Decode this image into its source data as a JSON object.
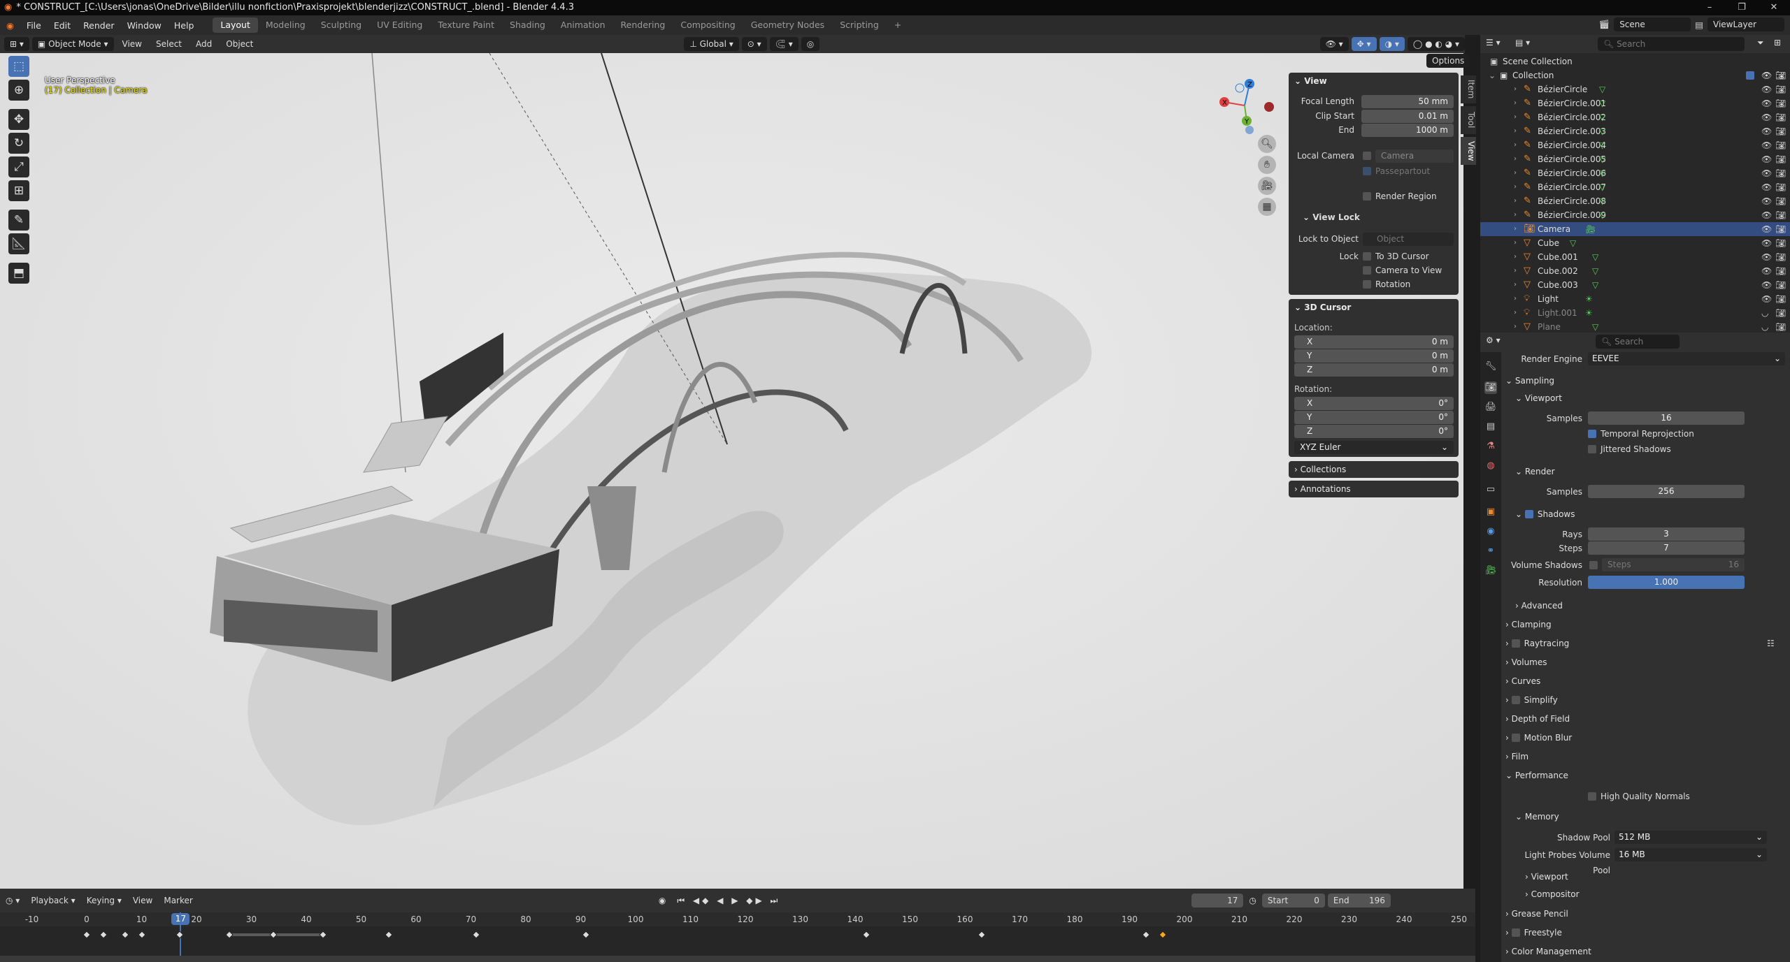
{
  "titlebar": {
    "title": "* CONSTRUCT_[C:\\Users\\jonas\\OneDrive\\Bilder\\illu nonfiction\\Praxisprojekt\\blenderjizz\\CONSTRUCT_.blend] - Blender 4.4.3",
    "minimize": "–",
    "maximize": "❐",
    "close": "✕"
  },
  "topbar": {
    "menus": [
      "File",
      "Edit",
      "Render",
      "Window",
      "Help"
    ],
    "workspaces": [
      "Layout",
      "Modeling",
      "Sculpting",
      "UV Editing",
      "Texture Paint",
      "Shading",
      "Animation",
      "Rendering",
      "Compositing",
      "Geometry Nodes",
      "Scripting"
    ],
    "active_workspace": "Layout",
    "add_tab": "+",
    "scene": "Scene",
    "view_layer": "ViewLayer"
  },
  "viewport_header": {
    "mode": "Object Mode",
    "menus": [
      "View",
      "Select",
      "Add",
      "Object"
    ],
    "transform": "Global",
    "options": "Options"
  },
  "viewport": {
    "perspective": "User Perspective",
    "collection_prefix": "(17) Collection | ",
    "active_object": "Camera",
    "axes": {
      "x": "X",
      "y": "Y",
      "z": "Z"
    }
  },
  "npanel": {
    "tabs": [
      "Item",
      "Tool",
      "View"
    ],
    "view": {
      "header": "View",
      "focal_length_label": "Focal Length",
      "focal_length": "50 mm",
      "clip_start_label": "Clip Start",
      "clip_start": "0.01 m",
      "end_label": "End",
      "end": "1000 m",
      "local_camera_label": "Local Camera",
      "local_camera": "Camera",
      "passepartout": "Passepartout",
      "render_region": "Render Region"
    },
    "view_lock": {
      "header": "View Lock",
      "lock_to_object_label": "Lock to Object",
      "lock_to_object_placeholder": "Object",
      "lock_label": "Lock",
      "to_3d_cursor": "To 3D Cursor",
      "camera_to_view": "Camera to View",
      "rotation": "Rotation"
    },
    "cursor": {
      "header": "3D Cursor",
      "location_label": "Location:",
      "rotation_label": "Rotation:",
      "loc": [
        {
          "axis": "X",
          "value": "0 m"
        },
        {
          "axis": "Y",
          "value": "0 m"
        },
        {
          "axis": "Z",
          "value": "0 m"
        }
      ],
      "rot": [
        {
          "axis": "X",
          "value": "0°"
        },
        {
          "axis": "Y",
          "value": "0°"
        },
        {
          "axis": "Z",
          "value": "0°"
        }
      ],
      "mode": "XYZ Euler"
    },
    "collections": "Collections",
    "annotations": "Annotations"
  },
  "timeline": {
    "menus": [
      "Playback",
      "Keying",
      "View",
      "Marker"
    ],
    "current_frame": "17",
    "start_label": "Start",
    "start": "0",
    "end_label": "End",
    "end": "196",
    "ticks": [
      "-10",
      "0",
      "10",
      "20",
      "30",
      "40",
      "50",
      "60",
      "70",
      "80",
      "90",
      "100",
      "110",
      "120",
      "130",
      "140",
      "150",
      "160",
      "170",
      "180",
      "190",
      "200",
      "210",
      "220",
      "230",
      "240",
      "250"
    ],
    "keyframes": [
      0,
      3,
      7,
      10,
      17,
      26,
      34,
      43,
      55,
      71,
      91,
      142,
      163,
      193,
      196
    ],
    "selected_keyframe": 196
  },
  "outliner": {
    "search_placeholder": "Search",
    "root": "Scene Collection",
    "collection": "Collection",
    "items": [
      {
        "name": "BézierCircle",
        "type": "curve"
      },
      {
        "name": "BézierCircle.001",
        "type": "curve"
      },
      {
        "name": "BézierCircle.002",
        "type": "curve"
      },
      {
        "name": "BézierCircle.003",
        "type": "curve"
      },
      {
        "name": "BézierCircle.004",
        "type": "curve"
      },
      {
        "name": "BézierCircle.005",
        "type": "curve"
      },
      {
        "name": "BézierCircle.006",
        "type": "curve"
      },
      {
        "name": "BézierCircle.007",
        "type": "curve"
      },
      {
        "name": "BézierCircle.008",
        "type": "curve"
      },
      {
        "name": "BézierCircle.009",
        "type": "curve"
      },
      {
        "name": "Camera",
        "type": "camera"
      },
      {
        "name": "Cube",
        "type": "mesh"
      },
      {
        "name": "Cube.001",
        "type": "mesh"
      },
      {
        "name": "Cube.002",
        "type": "mesh"
      },
      {
        "name": "Cube.003",
        "type": "mesh"
      },
      {
        "name": "Light",
        "type": "light"
      },
      {
        "name": "Light.001",
        "type": "light"
      },
      {
        "name": "Plane",
        "type": "mesh"
      }
    ],
    "selected": "Camera"
  },
  "properties": {
    "search_placeholder": "Search",
    "render_engine_label": "Render Engine",
    "render_engine": "EEVEE",
    "sampling": "Sampling",
    "viewport": "Viewport",
    "samples_label": "Samples",
    "viewport_samples": "16",
    "temporal_reprojection": "Temporal Reprojection",
    "jittered_shadows": "Jittered Shadows",
    "render": "Render",
    "render_samples": "256",
    "shadows": "Shadows",
    "rays_label": "Rays",
    "rays": "3",
    "steps_label": "Steps",
    "steps": "7",
    "volume_shadows_label": "Volume Shadows",
    "volume_steps_label": "Steps",
    "volume_steps": "16",
    "resolution_label": "Resolution",
    "resolution": "1.000",
    "advanced": "Advanced",
    "clamping": "Clamping",
    "raytracing": "Raytracing",
    "volumes": "Volumes",
    "curves": "Curves",
    "simplify": "Simplify",
    "depth_of_field": "Depth of Field",
    "motion_blur": "Motion Blur",
    "film": "Film",
    "performance": "Performance",
    "high_quality_normals": "High Quality Normals",
    "memory": "Memory",
    "shadow_pool_label": "Shadow Pool",
    "shadow_pool": "512 MB",
    "light_probes_label": "Light Probes Volume Pool",
    "light_probes": "16 MB",
    "viewport_sub": "Viewport",
    "compositor": "Compositor",
    "grease_pencil": "Grease Pencil",
    "freestyle": "Freestyle",
    "color_management": "Color Management"
  },
  "colors": {
    "accent": "#4772b3",
    "selection": "#334d80",
    "timeline_cursor": "#4772b3",
    "keyframe_selected": "#f5a623"
  }
}
